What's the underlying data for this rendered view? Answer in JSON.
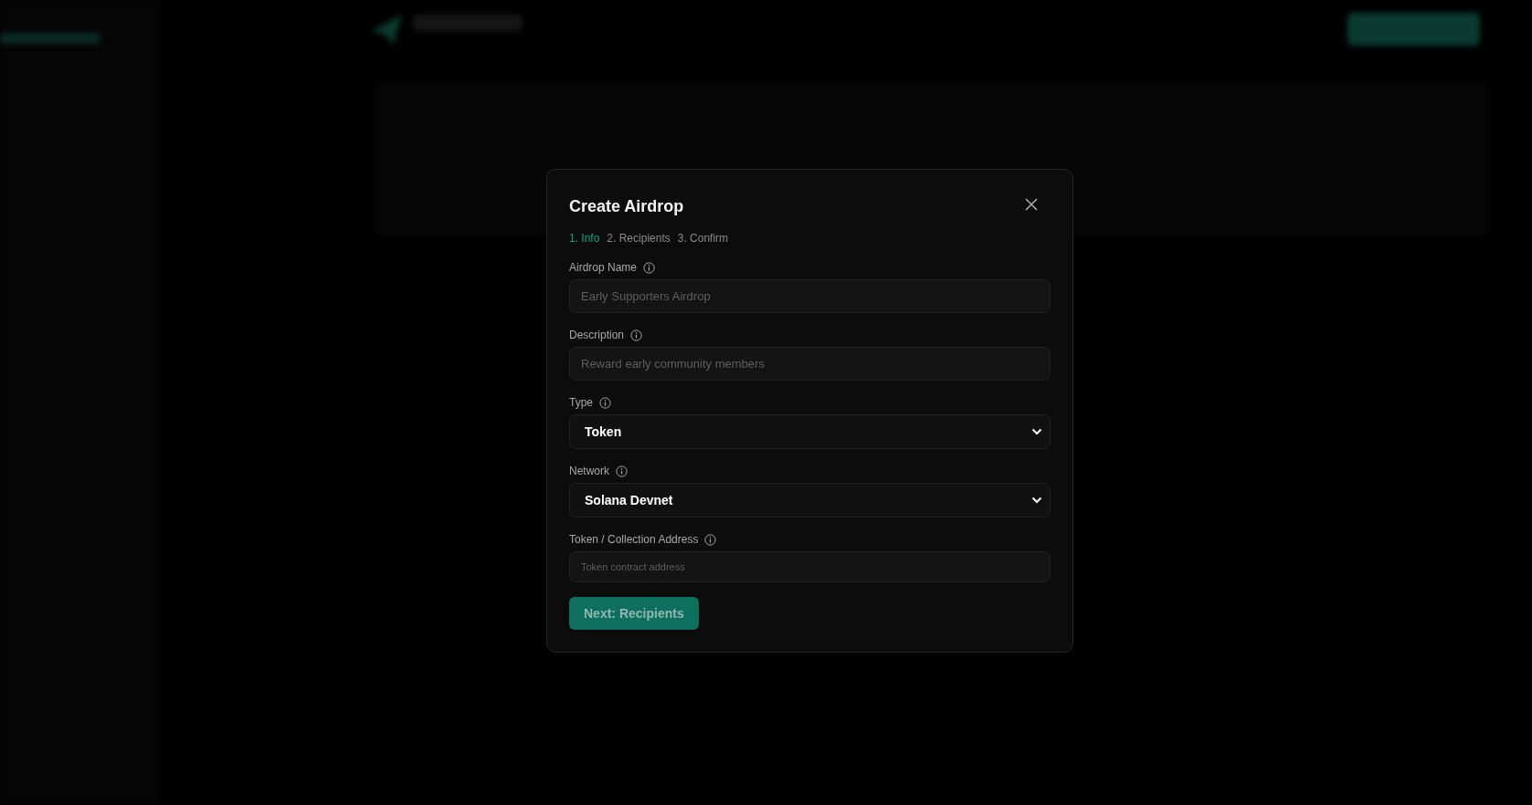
{
  "dialog": {
    "title": "Create Airdrop",
    "steps": [
      {
        "label": "1. Info",
        "selected": true
      },
      {
        "label": "2. Recipients",
        "selected": false
      },
      {
        "label": "3. Confirm",
        "selected": false
      }
    ],
    "fields": [
      {
        "kind": "text",
        "label": "Airdrop Name",
        "placeholder": "Early Supporters Airdrop"
      },
      {
        "kind": "text",
        "label": "Description",
        "placeholder": "Reward early community members"
      },
      {
        "kind": "select",
        "label": "Type",
        "value": "Token"
      },
      {
        "kind": "select",
        "label": "Network",
        "value": "Solana Devnet"
      },
      {
        "kind": "small",
        "label": "Token / Collection Address",
        "placeholder": "Token contract address"
      }
    ],
    "submit": "Next: Recipients"
  }
}
